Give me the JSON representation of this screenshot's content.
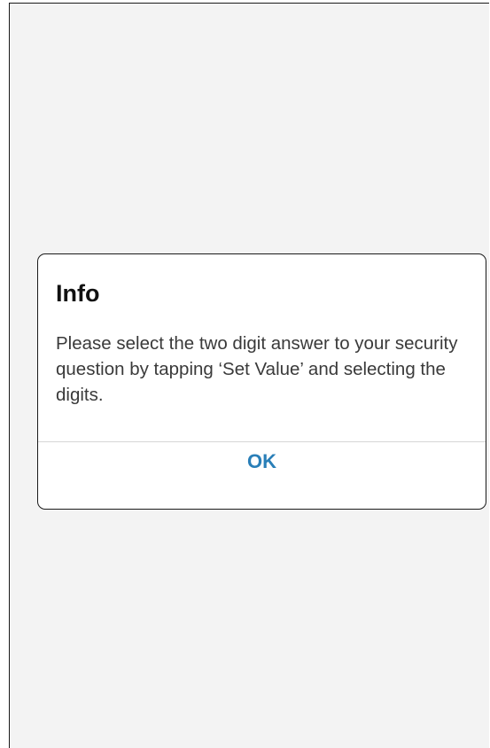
{
  "dialog": {
    "title": "Info",
    "message": "Please select the two digit answer to your security question by tapping ‘Set Value’ and selecting the digits.",
    "ok_label": "OK"
  },
  "colors": {
    "background": "#f3f3f3",
    "dialog_background": "#ffffff",
    "button_text": "#2a7fb8",
    "divider": "#d6d6d6"
  }
}
